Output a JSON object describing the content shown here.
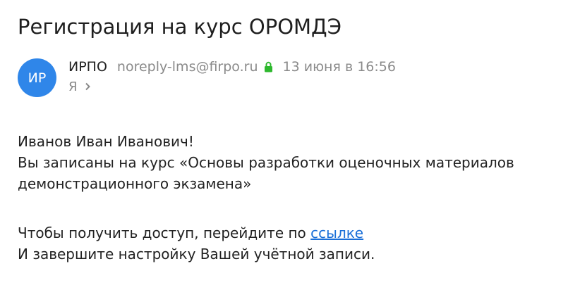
{
  "email": {
    "subject": "Регистрация на курс ОРОМДЭ",
    "avatar_initials": "ИР",
    "avatar_color": "#2f86e9",
    "sender_name": "ИРПО",
    "sender_email": "noreply-lms@firpo.ru",
    "lock_icon": "lock-icon",
    "lock_color": "#2eb82e",
    "date": "13 июня в 16:56",
    "recipient": "Я",
    "recipient_expand_icon": "chevron-right-icon",
    "body": {
      "greeting": "Иванов Иван Иванович!",
      "line1": "Вы записаны на курс «Основы разработки оценочных материалов",
      "line2": "демонстрационного экзамена»",
      "access_prefix": "Чтобы получить доступ, перейдите по ",
      "access_link": "ссылке",
      "link_color": "#1a6fd8",
      "finish_line": "И завершите настройку Вашей учётной записи."
    }
  }
}
